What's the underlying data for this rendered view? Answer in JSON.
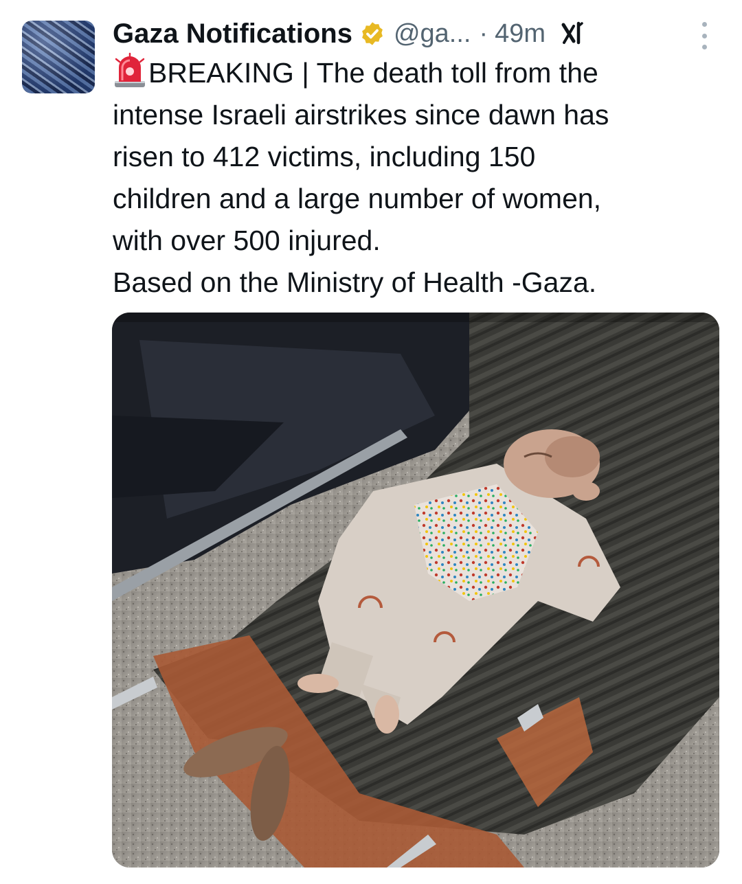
{
  "tweet": {
    "author": {
      "display_name": "Gaza Notifications",
      "verified": true,
      "verified_badge_color": "#e8b923",
      "handle": "@ga...",
      "avatar_icon": "crowd-photo-avatar"
    },
    "separator": "·",
    "time": "49m",
    "grok_icon": "grok-icon",
    "more_icon": "more-options-icon",
    "text_lines": [
      "BREAKING | The death toll from the",
      "intense Israeli airstrikes since dawn has",
      "risen to 412 victims, including 150",
      "children and a large number of women,",
      "with over 500 injured.",
      "Based on the Ministry of Health -Gaza."
    ],
    "emoji_icon": "police-siren-emoji",
    "media": {
      "type": "photo",
      "icon": "infant-on-stretcher-photo"
    }
  },
  "colors": {
    "text_primary": "#0f1419",
    "text_secondary": "#536471",
    "background": "#ffffff"
  }
}
